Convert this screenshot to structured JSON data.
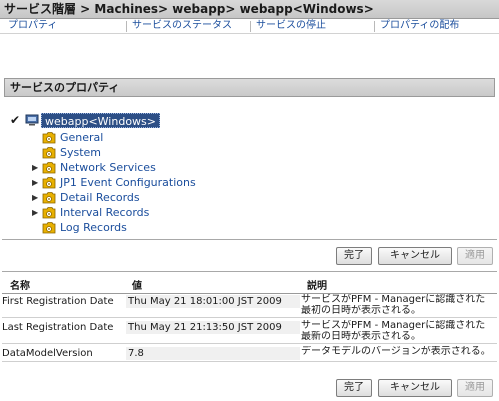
{
  "window": {
    "breadcrumb": "サービス階層 > Machines> webapp> webapp<Windows>"
  },
  "tabs": [
    {
      "label": "プロパティ"
    },
    {
      "label": "サービスのステータス"
    },
    {
      "label": "サービスの停止"
    },
    {
      "label": "プロパティの配布"
    }
  ],
  "panel": {
    "title": "サービスのプロパティ"
  },
  "tree": {
    "root": {
      "label": "webapp<Windows>",
      "checked": true,
      "icon": "monitor-icon"
    },
    "nodes": [
      {
        "label": "General",
        "expandable": false,
        "icon": "folder-icon"
      },
      {
        "label": "System",
        "expandable": false,
        "icon": "folder-icon"
      },
      {
        "label": "Network Services",
        "expandable": true,
        "icon": "folder-icon"
      },
      {
        "label": "JP1 Event Configurations",
        "expandable": true,
        "icon": "folder-icon"
      },
      {
        "label": "Detail Records",
        "expandable": true,
        "icon": "folder-icon"
      },
      {
        "label": "Interval Records",
        "expandable": true,
        "icon": "folder-icon"
      },
      {
        "label": "Log Records",
        "expandable": false,
        "icon": "folder-icon"
      }
    ]
  },
  "actions": {
    "ok": "完了",
    "cancel": "キャンセル",
    "apply": "適用"
  },
  "table": {
    "headers": {
      "name": "名称",
      "value": "値",
      "description": "説明"
    },
    "rows": [
      {
        "name": "First Registration Date",
        "value": "Thu May 21 18:01:00 JST 2009",
        "description": [
          "サービスがPFM - Managerに認識された",
          "最初の日時が表示される。"
        ]
      },
      {
        "name": "Last Registration Date",
        "value": "Thu May 21 21:13:50 JST 2009",
        "description": [
          "サービスがPFM - Managerに認識された",
          "最新の日時が表示される。"
        ]
      },
      {
        "name": "DataModelVersion",
        "value": "7.8",
        "description": [
          "データモデルのバージョンが表示される。"
        ]
      }
    ]
  },
  "colors": {
    "link": "#1a4d9c",
    "selected": "#2d4f86",
    "header_bg": "#d0d0d0"
  }
}
